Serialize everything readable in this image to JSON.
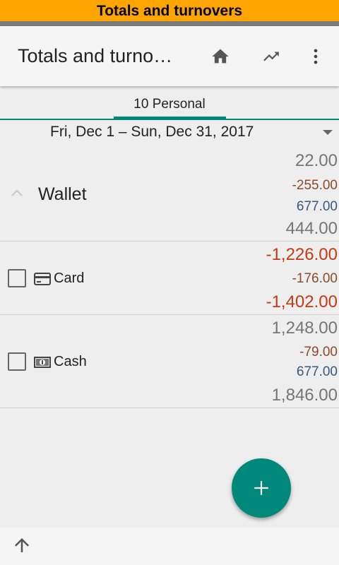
{
  "banner": {
    "title": "Totals and turnovers"
  },
  "appbar": {
    "title": "Totals and turno…",
    "icons": [
      "home-icon",
      "trending-up-icon",
      "more-vert-icon"
    ]
  },
  "tab": {
    "label": "10 Personal"
  },
  "period": {
    "label": "Fri, Dec 1 – Sun, Dec 31, 2017"
  },
  "group": {
    "label": "Wallet",
    "opening": "22.00",
    "expense": "-255.00",
    "income": "677.00",
    "closing": "444.00"
  },
  "accounts": [
    {
      "label": "Card",
      "icon": "credit-card-icon",
      "opening": "-1,226.00",
      "expense": "-176.00",
      "closing": "-1,402.00"
    },
    {
      "label": "Cash",
      "icon": "banknote-icon",
      "opening": "1,248.00",
      "expense": "-79.00",
      "income": "677.00",
      "closing": "1,846.00"
    }
  ],
  "colors": {
    "accent": "#00897b",
    "banner": "#ffa500",
    "negative": "#c63a12",
    "expense": "#8b4a2a",
    "income": "#37587a",
    "neutral": "#757575"
  },
  "fab": {
    "icon": "plus-icon"
  },
  "bottom": {
    "icon": "arrow-up-icon"
  }
}
